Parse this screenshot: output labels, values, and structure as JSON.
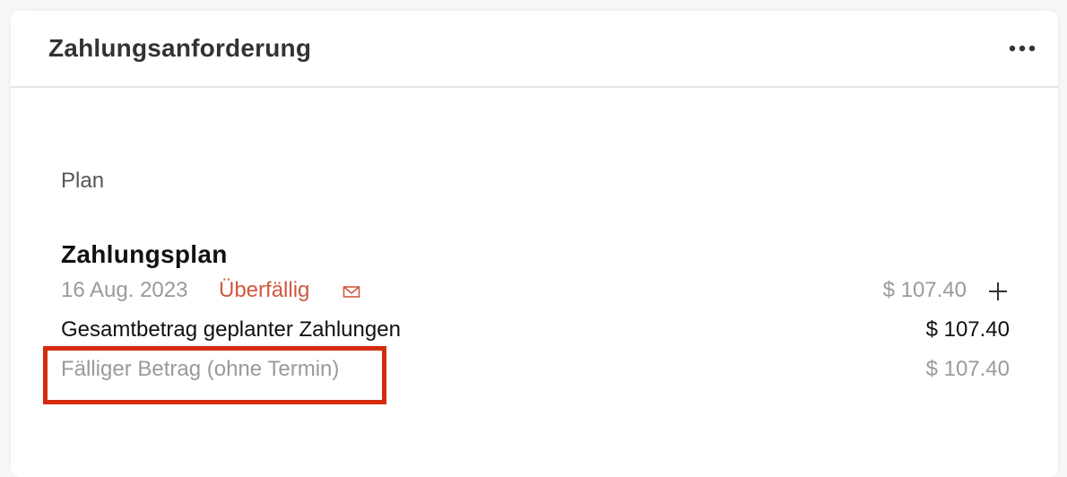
{
  "header": {
    "title": "Zahlungsanforderung",
    "more_icon": "more-horizontal-icon"
  },
  "section": {
    "label": "Plan"
  },
  "plan": {
    "title": "Zahlungsplan",
    "installment": {
      "date": "16 Aug. 2023",
      "status": "Überfällig",
      "status_color": "#d0583f",
      "notify_icon": "mail-icon",
      "amount": "$ 107.40",
      "add_icon": "plus-icon"
    },
    "total_row": {
      "label": "Gesamtbetrag geplanter Zahlungen",
      "amount": "$ 107.40"
    },
    "due_row": {
      "label": "Fälliger Betrag (ohne Termin)",
      "amount": "$ 107.40"
    }
  },
  "highlight": {
    "color": "#d42b0f"
  }
}
